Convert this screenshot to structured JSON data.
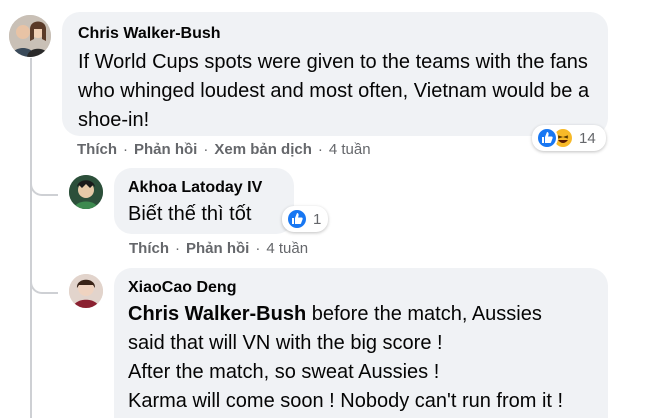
{
  "comments": [
    {
      "author": "Chris Walker-Bush",
      "text": "If World Cups spots were given to the teams with the fans who whinged loudest and most often, Vietnam would be a shoe-in!",
      "actions": {
        "like": "Thích",
        "reply": "Phản hồi",
        "translate": "Xem bản dịch",
        "time": "4 tuần"
      },
      "reactions": {
        "icons": [
          "like-icon",
          "haha-icon"
        ],
        "count": "14"
      }
    },
    {
      "author": "Akhoa Latoday IV",
      "text": "Biết thế thì tốt",
      "actions": {
        "like": "Thích",
        "reply": "Phản hồi",
        "time": "4 tuần"
      },
      "reactions": {
        "icons": [
          "like-icon"
        ],
        "count": "1"
      }
    },
    {
      "author": "XiaoCao Deng",
      "mention": "Chris Walker-Bush",
      "text_line1": " before the match, Aussies",
      "text_line2": "said that will VN with the big score !",
      "text_line3": "After the match, so sweat Aussies !",
      "text_line4": "Karma will come soon ! Nobody can't run from it !"
    }
  ],
  "separator": "·",
  "colors": {
    "bubble": "#f0f2f5",
    "secondary_text": "#65676b",
    "like_blue": "#1877f2",
    "haha_yellow": "#f7b928"
  }
}
